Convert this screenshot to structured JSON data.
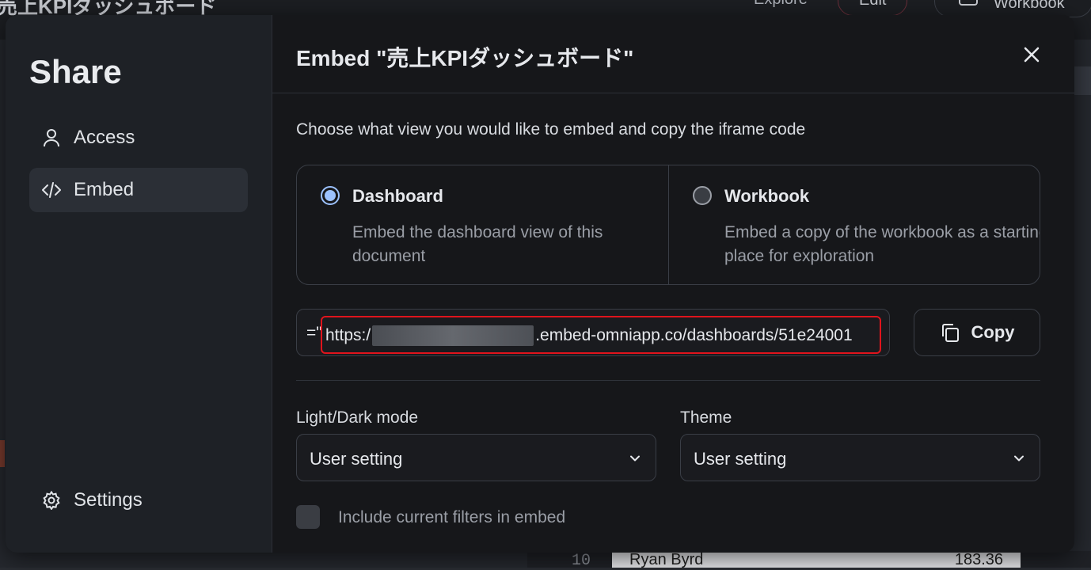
{
  "background": {
    "title": "売上KPIダッシュボード",
    "explore_label": "Explore",
    "edit_label": "Edit",
    "workbook_label": "Workbook",
    "row_number": "10",
    "row_name": "Ryan Byrd",
    "row_value": "183.36"
  },
  "sidebar": {
    "title": "Share",
    "items": [
      {
        "label": "Access",
        "icon": "user-icon"
      },
      {
        "label": "Embed",
        "icon": "code-icon"
      }
    ],
    "settings_label": "Settings"
  },
  "dialog": {
    "title": "Embed \"売上KPIダッシュボード\"",
    "description": "Choose what view you would like to embed and copy the iframe code",
    "options": [
      {
        "title": "Dashboard",
        "description": "Embed the dashboard view of this document",
        "selected": true
      },
      {
        "title": "Workbook",
        "description": "Embed a copy of the workbook as a starting place for exploration",
        "selected": false
      }
    ],
    "code": {
      "prefix": "=\"",
      "before": "https:/",
      "after": ".embed-omniapp.co/dashboards/51e24001"
    },
    "copy_label": "Copy",
    "light_dark": {
      "label": "Light/Dark mode",
      "value": "User setting"
    },
    "theme": {
      "label": "Theme",
      "value": "User setting"
    },
    "include_filters_label": "Include current filters in embed"
  },
  "colors": {
    "accent": "#9cc2ff",
    "highlight": "#e0141c",
    "modal_bg": "#16171a",
    "sidebar_bg": "#1e2126"
  }
}
